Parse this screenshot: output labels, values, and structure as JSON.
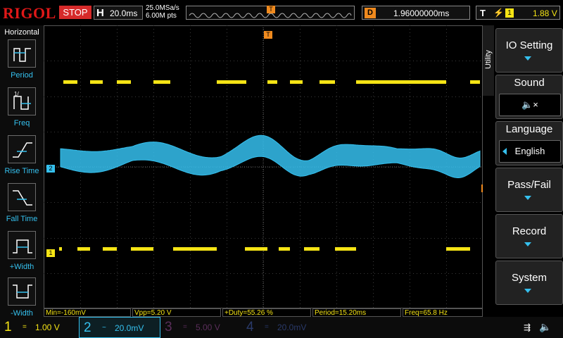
{
  "topbar": {
    "brand": "RIGOL",
    "run_state": "STOP",
    "timebase_label": "H",
    "timebase_value": "20.0ms",
    "sample_rate": "25.0MSa/s",
    "memory_depth": "6.00M pts",
    "trigger_marker": "T",
    "delay_label": "D",
    "delay_value": "1.96000000ms",
    "trigger_label": "T",
    "trigger_edge": "⚡",
    "trigger_source": "1",
    "trigger_level": "1.88 V"
  },
  "left_panel": {
    "title": "Horizontal",
    "items": [
      {
        "label": "Period",
        "icon": "period-icon"
      },
      {
        "label": "Freq",
        "icon": "freq-icon"
      },
      {
        "label": "Rise Time",
        "icon": "rise-time-icon"
      },
      {
        "label": "Fall Time",
        "icon": "fall-time-icon"
      },
      {
        "label": "+Width",
        "icon": "pos-width-icon"
      },
      {
        "label": "-Width",
        "icon": "neg-width-icon"
      }
    ]
  },
  "measurements": {
    "min": "Min=-160mV",
    "vpp": "Vpp=5.20 V",
    "duty": "+Duty=55.26 %",
    "period": "Period=15.20ms",
    "freq": "Freq=65.8 Hz"
  },
  "markers": {
    "ch2": "2",
    "ch1": "1",
    "trigger_level": "T",
    "trigger_pos": "T"
  },
  "right_menu": {
    "tab": "Utility",
    "buttons": [
      {
        "label": "IO Setting",
        "kind": "arrow"
      },
      {
        "label": "Sound",
        "kind": "value",
        "value_icon": "speaker-mute-icon",
        "value": "🔈×"
      },
      {
        "label": "Language",
        "kind": "value",
        "value": "English"
      },
      {
        "label": "Pass/Fail",
        "kind": "arrow"
      },
      {
        "label": "Record",
        "kind": "arrow"
      },
      {
        "label": "System",
        "kind": "arrow"
      }
    ]
  },
  "channels": [
    {
      "num": "1",
      "coupling": "=",
      "scale": "1.00 V",
      "color": "#f5e415"
    },
    {
      "num": "2",
      "coupling": "~",
      "scale": "20.0mV",
      "color": "#35c0ee"
    },
    {
      "num": "3",
      "coupling": "=",
      "scale": "5.00 V",
      "color": "#5a2e5a"
    },
    {
      "num": "4",
      "coupling": "=",
      "scale": "20.0mV",
      "color": "#2a3a6a"
    }
  ],
  "status": {
    "usb_icon": "usb-icon",
    "sound_icon": "speaker-mute-icon"
  },
  "colors": {
    "ch1": "#f5e415",
    "ch2": "#35c0ee",
    "accent": "#f08a1e",
    "stop": "#d62a2a"
  }
}
